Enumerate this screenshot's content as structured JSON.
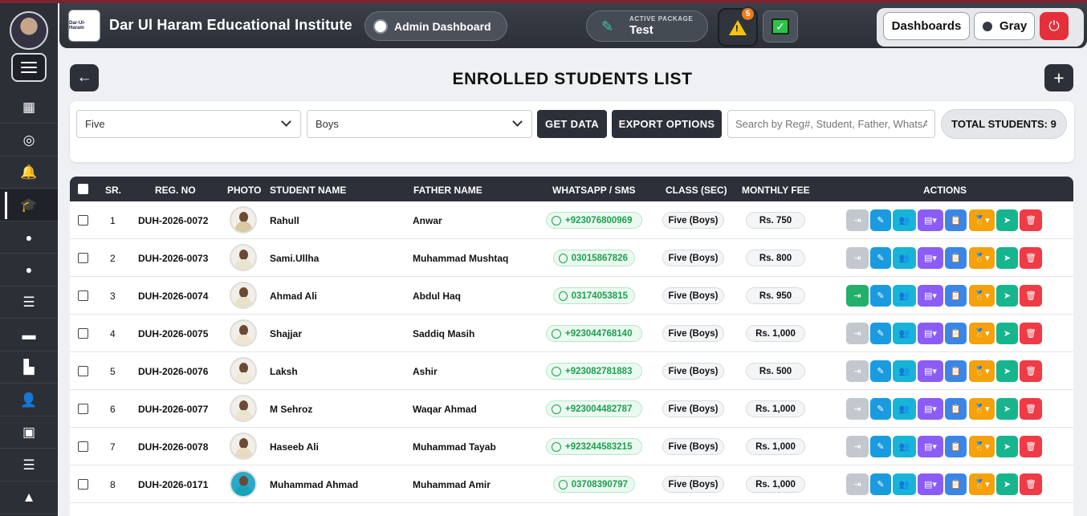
{
  "header": {
    "institute_name": "Dar Ul Haram Educational Institute",
    "logo_text": "Dar-Ul-Haram",
    "dashboard_pill": "Admin Dashboard",
    "package_label": "ACTIVE PACKAGE",
    "package_value": "Test",
    "alert_count": "5",
    "dashboards_button": "Dashboards",
    "theme_button": "Gray"
  },
  "sidebar": {
    "icons": [
      "dashboard-icon",
      "globe-icon",
      "bell-icon",
      "graduation-cap-icon",
      "circle-icon",
      "circle-icon",
      "list-icon",
      "card-icon",
      "book-icon",
      "user-icon",
      "grid-icon",
      "list-icon",
      "building-icon"
    ],
    "active_index": 3
  },
  "page": {
    "title": "ENROLLED STUDENTS LIST"
  },
  "filters": {
    "class_value": "Five",
    "section_value": "Boys",
    "get_data_label": "GET DATA",
    "export_label": "EXPORT OPTIONS",
    "search_placeholder": "Search by Reg#, Student, Father, WhatsA",
    "total_label": "TOTAL STUDENTS: 9"
  },
  "table": {
    "headers": [
      "SR.",
      "REG. NO",
      "PHOTO",
      "STUDENT NAME",
      "FATHER NAME",
      "WHATSAPP / SMS",
      "CLASS (SEC)",
      "MONTHLY FEE",
      "ACTIONS"
    ],
    "rows": [
      {
        "sr": "1",
        "reg": "DUH-2026-0072",
        "name": "Rahull",
        "father": "Anwar",
        "phone": "+923076800969",
        "class": "Five (Boys)",
        "fee": "Rs. 750",
        "login_active": false
      },
      {
        "sr": "2",
        "reg": "DUH-2026-0073",
        "name": "Sami.Ullha",
        "father": "Muhammad Mushtaq",
        "phone": "03015867826",
        "class": "Five (Boys)",
        "fee": "Rs. 800",
        "login_active": false
      },
      {
        "sr": "3",
        "reg": "DUH-2026-0074",
        "name": "Ahmad Ali",
        "father": "Abdul Haq",
        "phone": "03174053815",
        "class": "Five (Boys)",
        "fee": "Rs. 950",
        "login_active": true
      },
      {
        "sr": "4",
        "reg": "DUH-2026-0075",
        "name": "Shajjar",
        "father": "Saddiq Masih",
        "phone": "+923044768140",
        "class": "Five (Boys)",
        "fee": "Rs. 1,000",
        "login_active": false
      },
      {
        "sr": "5",
        "reg": "DUH-2026-0076",
        "name": "Laksh",
        "father": "Ashir",
        "phone": "+923082781883",
        "class": "Five (Boys)",
        "fee": "Rs. 500",
        "login_active": false
      },
      {
        "sr": "6",
        "reg": "DUH-2026-0077",
        "name": "M Sehroz",
        "father": "Waqar Ahmad",
        "phone": "+923004482787",
        "class": "Five (Boys)",
        "fee": "Rs. 1,000",
        "login_active": false
      },
      {
        "sr": "7",
        "reg": "DUH-2026-0078",
        "name": "Haseeb Ali",
        "father": "Muhammad Tayab",
        "phone": "+923244583215",
        "class": "Five (Boys)",
        "fee": "Rs. 1,000",
        "login_active": false
      },
      {
        "sr": "8",
        "reg": "DUH-2026-0171",
        "name": "Muhammad Ahmad",
        "father": "Muhammad Amir",
        "phone": "03708390797",
        "class": "Five (Boys)",
        "fee": "Rs. 1,000",
        "login_active": false
      }
    ],
    "actions": [
      {
        "name": "login-button",
        "icon": "⇥",
        "color": "#c3c8cf"
      },
      {
        "name": "edit-button",
        "icon": "✎",
        "color": "#1a9be0"
      },
      {
        "name": "family-button",
        "icon": "👥",
        "color": "#18b4d8"
      },
      {
        "name": "id-card-button",
        "icon": "▤▾",
        "color": "#8b5cf6"
      },
      {
        "name": "clipboard-button",
        "icon": "📋",
        "color": "#3a86e8"
      },
      {
        "name": "certificate-button",
        "icon": "🏅▾",
        "color": "#f4a10c"
      },
      {
        "name": "send-button",
        "icon": "➤",
        "color": "#16b58e"
      },
      {
        "name": "delete-button",
        "icon": "🗑",
        "color": "#ee3b45"
      }
    ],
    "login_active_color": "#22b06a"
  }
}
